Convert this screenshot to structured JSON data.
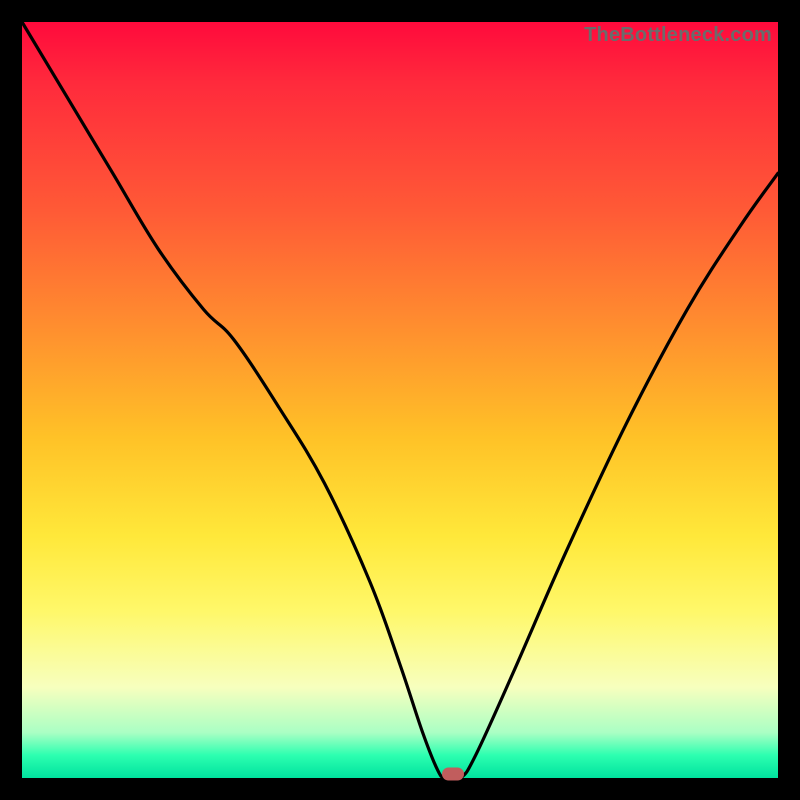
{
  "watermark": "TheBottleneck.com",
  "colors": {
    "curve": "#000000",
    "marker": "#c15d5d",
    "frame": "#000000"
  },
  "chart_data": {
    "type": "line",
    "title": "",
    "xlabel": "",
    "ylabel": "",
    "xlim": [
      0,
      100
    ],
    "ylim": [
      0,
      100
    ],
    "grid": false,
    "legend": false,
    "series": [
      {
        "name": "bottleneck-curve",
        "x": [
          0,
          6,
          12,
          18,
          24,
          28,
          34,
          40,
          46,
          50,
          53,
          55,
          56,
          58,
          60,
          65,
          72,
          80,
          88,
          95,
          100
        ],
        "y": [
          100,
          90,
          80,
          70,
          62,
          58,
          49,
          39,
          26,
          15,
          6,
          1,
          0,
          0,
          3,
          14,
          30,
          47,
          62,
          73,
          80
        ]
      }
    ],
    "marker": {
      "x": 57,
      "y": 0.5
    },
    "background_gradient_stops": [
      {
        "pos": 0.0,
        "color": "#ff0a3c"
      },
      {
        "pos": 0.25,
        "color": "#ff5a36"
      },
      {
        "pos": 0.55,
        "color": "#ffc227"
      },
      {
        "pos": 0.78,
        "color": "#fff86a"
      },
      {
        "pos": 0.94,
        "color": "#aaffc4"
      },
      {
        "pos": 1.0,
        "color": "#00e29e"
      }
    ]
  }
}
